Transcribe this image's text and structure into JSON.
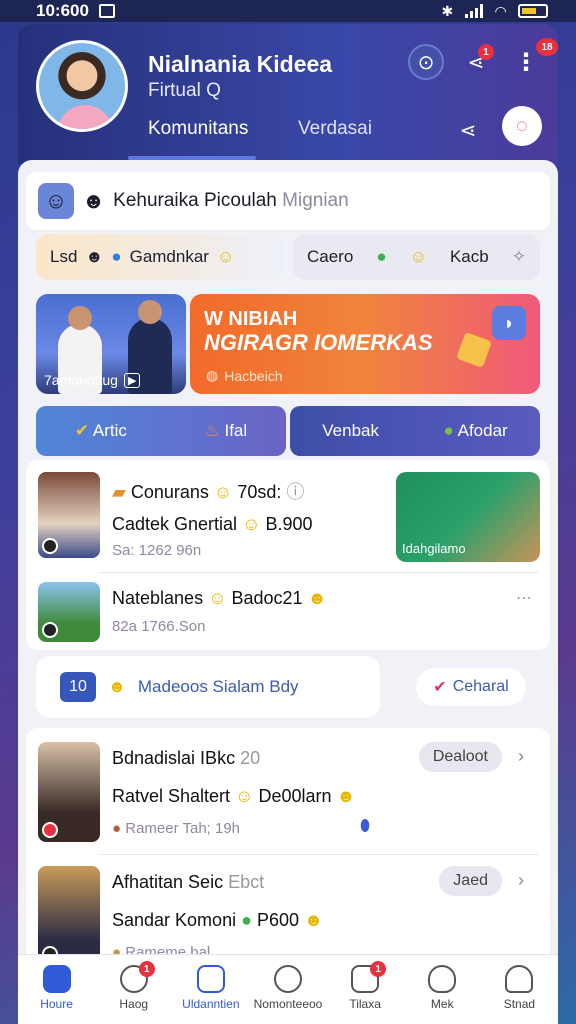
{
  "status_bar": {
    "time": "10:600"
  },
  "profile": {
    "name": "Nialnania Kideea",
    "subtitle": "Firtual Q",
    "tabs": [
      "Komunitans",
      "Verdasai"
    ]
  },
  "intro": {
    "text": "Kehuraika Picoulah",
    "muted": "Mignian"
  },
  "chips": [
    {
      "label": "Lsd",
      "trail": "Gamdnkar"
    },
    {
      "label": "Caero",
      "trail": "Kacb"
    }
  ],
  "banners": {
    "left_caption": "7amonottug",
    "right_title_1": "W NIBIAH",
    "right_title_2": "NGIRAGR IOMERKAS",
    "right_caption": "Hacbeich"
  },
  "actions": [
    {
      "left": "Artic",
      "right": "Ifal"
    },
    {
      "left": "Venbak",
      "right": "Afodar"
    }
  ],
  "feed": [
    {
      "title": "Conurans",
      "title_tail": "70sd:",
      "line": "Cadtek Gnertial",
      "line_tail": "B.900",
      "meta": "Sa: 1262 96n"
    },
    {
      "title": "Nateblanes",
      "title_tail": "Badoc21",
      "meta": "82a 1766.Son"
    }
  ],
  "promo": {
    "label": "Idahgilamo"
  },
  "pill": {
    "number": "10",
    "text": "Madeoos Sialam",
    "text_tail": "Bdy",
    "right": "Ceharal"
  },
  "feed2": [
    {
      "title": "Bdnadislai IBkc",
      "title_tail": "20",
      "tag": "Dealoot",
      "line": "Ratvel Shaltert",
      "line_tail": "De00larn",
      "meta": "Rameer Tah; 19h"
    },
    {
      "title": "Afhatitan Seic",
      "title_tail": "Ebct",
      "tag": "Jaed",
      "line": "Sandar Komoni",
      "line_tail": "P600",
      "meta": "Rameme bal"
    }
  ],
  "nav": [
    {
      "label": "Houre",
      "icon": "home-icon",
      "active": true
    },
    {
      "label": "Haog",
      "icon": "chat-icon",
      "badge": "1"
    },
    {
      "label": "Uldanntien",
      "icon": "tablet-icon"
    },
    {
      "label": "Nomonteeoo",
      "icon": "comment-icon"
    },
    {
      "label": "Tilaxa",
      "icon": "message-icon",
      "badge": "1"
    },
    {
      "label": "Mek",
      "icon": "heart-icon"
    },
    {
      "label": "Stnad",
      "icon": "person-icon"
    }
  ],
  "colors": {
    "accent": "#2f5bd6",
    "header": "#26307a",
    "badge": "#e8313f"
  }
}
